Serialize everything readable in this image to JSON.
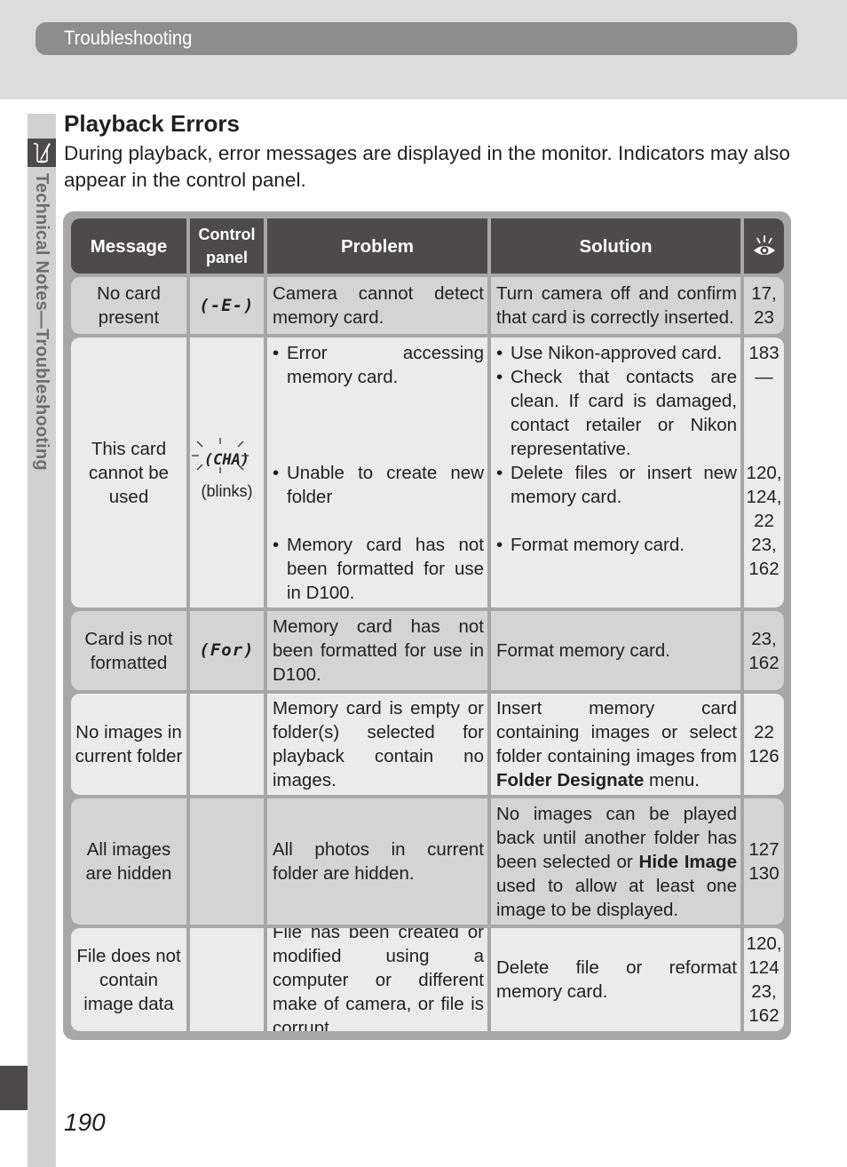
{
  "header": {
    "section": "Troubleshooting"
  },
  "sidebar": {
    "label": "Technical Notes—Troubleshooting",
    "icon": "pen-note-icon"
  },
  "page": {
    "title": "Playback Errors",
    "intro": "During playback, error messages are displayed in the monitor.  Indicators may also appear in the control panel.",
    "number": "190"
  },
  "table": {
    "headers": {
      "message": "Message",
      "control_panel_line1": "Control",
      "control_panel_line2": "panel",
      "problem": "Problem",
      "solution": "Solution",
      "ref_icon": "eye-icon"
    },
    "rows": [
      {
        "message": "No card present",
        "control_panel": "(-E-)",
        "problem": "Camera cannot detect memory card.",
        "solution": "Turn camera off and confirm that card is correctly inserted.",
        "refs": "17, 23"
      },
      {
        "message": "This card cannot be used",
        "control_panel": "(CHA)",
        "control_panel_note": "(blinks)",
        "problems": [
          "Error accessing memory card.",
          "Unable to create new folder",
          "Memory card has not been formatted for use in D100."
        ],
        "solutions": [
          "Use Nikon-approved card.",
          "Check that contacts are clean.  If card is damaged, contact retailer or Nikon representative.",
          "Delete files or insert new memory card.",
          "Format memory card."
        ],
        "refs": [
          "183",
          "—",
          "120,",
          "124,",
          "22",
          "23,",
          "162"
        ]
      },
      {
        "message": "Card is not formatted",
        "control_panel": "(For)",
        "problem": "Memory card has not been formatted for use in D100.",
        "solution": "Format memory card.",
        "refs": [
          "23,",
          "162"
        ]
      },
      {
        "message": "No images in current folder",
        "control_panel": "",
        "problem": "Memory card is empty or folder(s) selected for playback contain no images.",
        "solution_pre": "Insert memory card containing images or select folder containing images from ",
        "solution_bold": "Folder Designate",
        "solution_post": " menu.",
        "refs": [
          "22",
          "126"
        ]
      },
      {
        "message": "All images are hidden",
        "control_panel": "",
        "problem": "All photos in current folder are hidden.",
        "solution_pre": "No images can be played back until another folder has been selected or ",
        "solution_bold": "Hide Image",
        "solution_post": " used to allow at least one image to be displayed.",
        "refs": [
          "127",
          "130"
        ]
      },
      {
        "message": "File does not contain image data",
        "control_panel": "",
        "problem": "File has been created or modified using a computer or different make of camera, or file is corrupt.",
        "solution": "Delete file or reformat memory card.",
        "refs": [
          "120,",
          "124",
          "23,",
          "162"
        ]
      }
    ]
  }
}
